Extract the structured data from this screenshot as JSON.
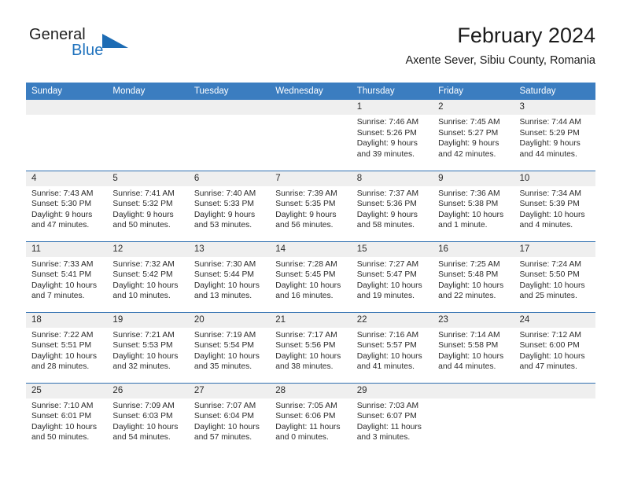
{
  "brand": {
    "name_part1": "General",
    "name_part2": "Blue",
    "logo_icon": "triangle-logo-icon"
  },
  "header": {
    "month_title": "February 2024",
    "location": "Axente Sever, Sibiu County, Romania",
    "accent_color": "#3b7dc0",
    "brand_blue": "#1f72bd",
    "daynum_bg": "#efefef"
  },
  "weekday_headers": [
    "Sunday",
    "Monday",
    "Tuesday",
    "Wednesday",
    "Thursday",
    "Friday",
    "Saturday"
  ],
  "labels": {
    "sunrise": "Sunrise:",
    "sunset": "Sunset:",
    "daylight": "Daylight:"
  },
  "weeks": [
    [
      {
        "day": "",
        "empty": true
      },
      {
        "day": "",
        "empty": true
      },
      {
        "day": "",
        "empty": true
      },
      {
        "day": "",
        "empty": true
      },
      {
        "day": "1",
        "sunrise": "Sunrise: 7:46 AM",
        "sunset": "Sunset: 5:26 PM",
        "daylight_line1": "Daylight: 9 hours",
        "daylight_line2": "and 39 minutes."
      },
      {
        "day": "2",
        "sunrise": "Sunrise: 7:45 AM",
        "sunset": "Sunset: 5:27 PM",
        "daylight_line1": "Daylight: 9 hours",
        "daylight_line2": "and 42 minutes."
      },
      {
        "day": "3",
        "sunrise": "Sunrise: 7:44 AM",
        "sunset": "Sunset: 5:29 PM",
        "daylight_line1": "Daylight: 9 hours",
        "daylight_line2": "and 44 minutes."
      }
    ],
    [
      {
        "day": "4",
        "sunrise": "Sunrise: 7:43 AM",
        "sunset": "Sunset: 5:30 PM",
        "daylight_line1": "Daylight: 9 hours",
        "daylight_line2": "and 47 minutes."
      },
      {
        "day": "5",
        "sunrise": "Sunrise: 7:41 AM",
        "sunset": "Sunset: 5:32 PM",
        "daylight_line1": "Daylight: 9 hours",
        "daylight_line2": "and 50 minutes."
      },
      {
        "day": "6",
        "sunrise": "Sunrise: 7:40 AM",
        "sunset": "Sunset: 5:33 PM",
        "daylight_line1": "Daylight: 9 hours",
        "daylight_line2": "and 53 minutes."
      },
      {
        "day": "7",
        "sunrise": "Sunrise: 7:39 AM",
        "sunset": "Sunset: 5:35 PM",
        "daylight_line1": "Daylight: 9 hours",
        "daylight_line2": "and 56 minutes."
      },
      {
        "day": "8",
        "sunrise": "Sunrise: 7:37 AM",
        "sunset": "Sunset: 5:36 PM",
        "daylight_line1": "Daylight: 9 hours",
        "daylight_line2": "and 58 minutes."
      },
      {
        "day": "9",
        "sunrise": "Sunrise: 7:36 AM",
        "sunset": "Sunset: 5:38 PM",
        "daylight_line1": "Daylight: 10 hours",
        "daylight_line2": "and 1 minute."
      },
      {
        "day": "10",
        "sunrise": "Sunrise: 7:34 AM",
        "sunset": "Sunset: 5:39 PM",
        "daylight_line1": "Daylight: 10 hours",
        "daylight_line2": "and 4 minutes."
      }
    ],
    [
      {
        "day": "11",
        "sunrise": "Sunrise: 7:33 AM",
        "sunset": "Sunset: 5:41 PM",
        "daylight_line1": "Daylight: 10 hours",
        "daylight_line2": "and 7 minutes."
      },
      {
        "day": "12",
        "sunrise": "Sunrise: 7:32 AM",
        "sunset": "Sunset: 5:42 PM",
        "daylight_line1": "Daylight: 10 hours",
        "daylight_line2": "and 10 minutes."
      },
      {
        "day": "13",
        "sunrise": "Sunrise: 7:30 AM",
        "sunset": "Sunset: 5:44 PM",
        "daylight_line1": "Daylight: 10 hours",
        "daylight_line2": "and 13 minutes."
      },
      {
        "day": "14",
        "sunrise": "Sunrise: 7:28 AM",
        "sunset": "Sunset: 5:45 PM",
        "daylight_line1": "Daylight: 10 hours",
        "daylight_line2": "and 16 minutes."
      },
      {
        "day": "15",
        "sunrise": "Sunrise: 7:27 AM",
        "sunset": "Sunset: 5:47 PM",
        "daylight_line1": "Daylight: 10 hours",
        "daylight_line2": "and 19 minutes."
      },
      {
        "day": "16",
        "sunrise": "Sunrise: 7:25 AM",
        "sunset": "Sunset: 5:48 PM",
        "daylight_line1": "Daylight: 10 hours",
        "daylight_line2": "and 22 minutes."
      },
      {
        "day": "17",
        "sunrise": "Sunrise: 7:24 AM",
        "sunset": "Sunset: 5:50 PM",
        "daylight_line1": "Daylight: 10 hours",
        "daylight_line2": "and 25 minutes."
      }
    ],
    [
      {
        "day": "18",
        "sunrise": "Sunrise: 7:22 AM",
        "sunset": "Sunset: 5:51 PM",
        "daylight_line1": "Daylight: 10 hours",
        "daylight_line2": "and 28 minutes."
      },
      {
        "day": "19",
        "sunrise": "Sunrise: 7:21 AM",
        "sunset": "Sunset: 5:53 PM",
        "daylight_line1": "Daylight: 10 hours",
        "daylight_line2": "and 32 minutes."
      },
      {
        "day": "20",
        "sunrise": "Sunrise: 7:19 AM",
        "sunset": "Sunset: 5:54 PM",
        "daylight_line1": "Daylight: 10 hours",
        "daylight_line2": "and 35 minutes."
      },
      {
        "day": "21",
        "sunrise": "Sunrise: 7:17 AM",
        "sunset": "Sunset: 5:56 PM",
        "daylight_line1": "Daylight: 10 hours",
        "daylight_line2": "and 38 minutes."
      },
      {
        "day": "22",
        "sunrise": "Sunrise: 7:16 AM",
        "sunset": "Sunset: 5:57 PM",
        "daylight_line1": "Daylight: 10 hours",
        "daylight_line2": "and 41 minutes."
      },
      {
        "day": "23",
        "sunrise": "Sunrise: 7:14 AM",
        "sunset": "Sunset: 5:58 PM",
        "daylight_line1": "Daylight: 10 hours",
        "daylight_line2": "and 44 minutes."
      },
      {
        "day": "24",
        "sunrise": "Sunrise: 7:12 AM",
        "sunset": "Sunset: 6:00 PM",
        "daylight_line1": "Daylight: 10 hours",
        "daylight_line2": "and 47 minutes."
      }
    ],
    [
      {
        "day": "25",
        "sunrise": "Sunrise: 7:10 AM",
        "sunset": "Sunset: 6:01 PM",
        "daylight_line1": "Daylight: 10 hours",
        "daylight_line2": "and 50 minutes."
      },
      {
        "day": "26",
        "sunrise": "Sunrise: 7:09 AM",
        "sunset": "Sunset: 6:03 PM",
        "daylight_line1": "Daylight: 10 hours",
        "daylight_line2": "and 54 minutes."
      },
      {
        "day": "27",
        "sunrise": "Sunrise: 7:07 AM",
        "sunset": "Sunset: 6:04 PM",
        "daylight_line1": "Daylight: 10 hours",
        "daylight_line2": "and 57 minutes."
      },
      {
        "day": "28",
        "sunrise": "Sunrise: 7:05 AM",
        "sunset": "Sunset: 6:06 PM",
        "daylight_line1": "Daylight: 11 hours",
        "daylight_line2": "and 0 minutes."
      },
      {
        "day": "29",
        "sunrise": "Sunrise: 7:03 AM",
        "sunset": "Sunset: 6:07 PM",
        "daylight_line1": "Daylight: 11 hours",
        "daylight_line2": "and 3 minutes."
      },
      {
        "day": "",
        "empty": true
      },
      {
        "day": "",
        "empty": true
      }
    ]
  ]
}
